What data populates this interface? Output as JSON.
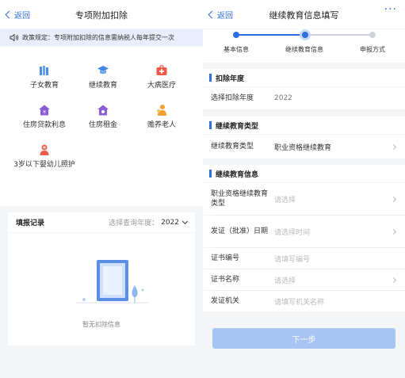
{
  "left": {
    "nav": {
      "back_label": "返回",
      "title": "专项附加扣除"
    },
    "notice": "政策规定：专项附加扣除的信息需纳税人每年提交一次",
    "categories": [
      {
        "label": "子女教育",
        "icon": "child-education-icon",
        "color": "#4a8ee6"
      },
      {
        "label": "继续教育",
        "icon": "graduation-cap-icon",
        "color": "#3f86e8"
      },
      {
        "label": "大病医疗",
        "icon": "medical-kit-icon",
        "color": "#ef5b4b"
      },
      {
        "label": "住房贷款利息",
        "icon": "house-loan-icon",
        "color": "#8a5cd6"
      },
      {
        "label": "住房租金",
        "icon": "house-rent-icon",
        "color": "#8a5cd6"
      },
      {
        "label": "赡养老人",
        "icon": "elderly-icon",
        "color": "#f0a030"
      },
      {
        "label": "3岁以下婴幼儿照护",
        "icon": "infant-care-icon",
        "color": "#ef5b4b"
      }
    ],
    "records": {
      "title": "填报记录",
      "year_prompt": "选择查询年度：",
      "year_value": "2022",
      "empty_text": "暂无扣除信息"
    }
  },
  "right": {
    "nav": {
      "back_label": "返回",
      "title": "继续教育信息填写",
      "more_label": "···"
    },
    "steps": [
      {
        "label": "基本信息",
        "state": "done"
      },
      {
        "label": "继续教育信息",
        "state": "current"
      },
      {
        "label": "申报方式",
        "state": "pending"
      }
    ],
    "sections": {
      "year_section": "扣除年度",
      "type_section": "继续教育类型",
      "info_section": "继续教育信息"
    },
    "fields": {
      "year_label": "选择扣除年度",
      "year_value": "2022",
      "type_label": "继续教育类型",
      "type_value": "职业资格继续教育",
      "cert_type_label": "职业资格继续教育类型",
      "cert_type_placeholder": "请选择",
      "issue_date_label": "发证（批准）日期",
      "issue_date_placeholder": "请选择时间",
      "cert_no_label": "证书编号",
      "cert_no_placeholder": "请填写编号",
      "cert_name_label": "证书名称",
      "cert_name_placeholder": "请选择",
      "authority_label": "发证机关",
      "authority_placeholder": "请填写机关名称"
    },
    "next_label": "下一步"
  },
  "colors": {
    "accent": "#2f6fe0",
    "disabled_button": "#a8c4f2",
    "page_bg": "#f4f5f7"
  }
}
